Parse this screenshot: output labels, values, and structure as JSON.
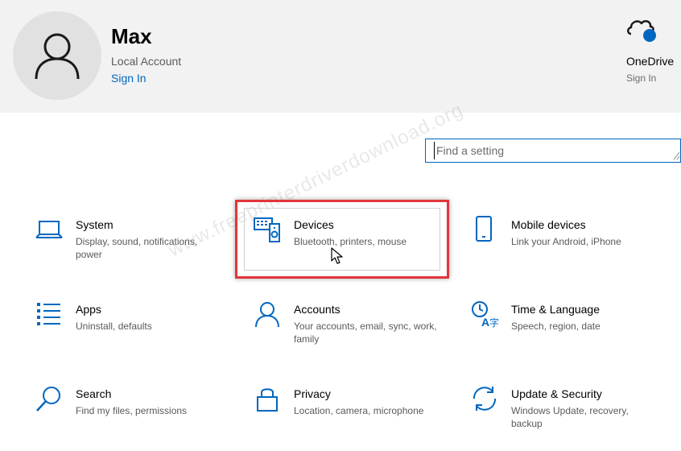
{
  "account": {
    "name": "Max",
    "type": "Local Account",
    "sign_in": "Sign In"
  },
  "onedrive": {
    "label": "OneDrive",
    "status": "Sign In",
    "icon": "cloud-icon",
    "status_color": "#0067c0"
  },
  "search": {
    "placeholder": "Find a setting",
    "value": ""
  },
  "watermark": "www.freeprinterdriverdownload.org",
  "accent_color": "#0067c0",
  "highlight_color": "#e2353a",
  "tiles": [
    {
      "title": "System",
      "description": "Display, sound, notifications, power",
      "icon": "laptop-icon"
    },
    {
      "title": "Devices",
      "description": "Bluetooth, printers, mouse",
      "icon": "devices-icon"
    },
    {
      "title": "Mobile devices",
      "description": "Link your Android, iPhone",
      "icon": "phone-icon"
    },
    {
      "title": "Apps",
      "description": "Uninstall, defaults",
      "icon": "apps-list-icon"
    },
    {
      "title": "Accounts",
      "description": "Your accounts, email, sync, work, family",
      "icon": "person-icon"
    },
    {
      "title": "Time & Language",
      "description": "Speech, region, date",
      "icon": "time-language-icon"
    },
    {
      "title": "Search",
      "description": "Find my files, permissions",
      "icon": "search-icon"
    },
    {
      "title": "Privacy",
      "description": "Location, camera, microphone",
      "icon": "lock-icon"
    },
    {
      "title": "Update & Security",
      "description": "Windows Update, recovery, backup",
      "icon": "sync-icon"
    }
  ]
}
